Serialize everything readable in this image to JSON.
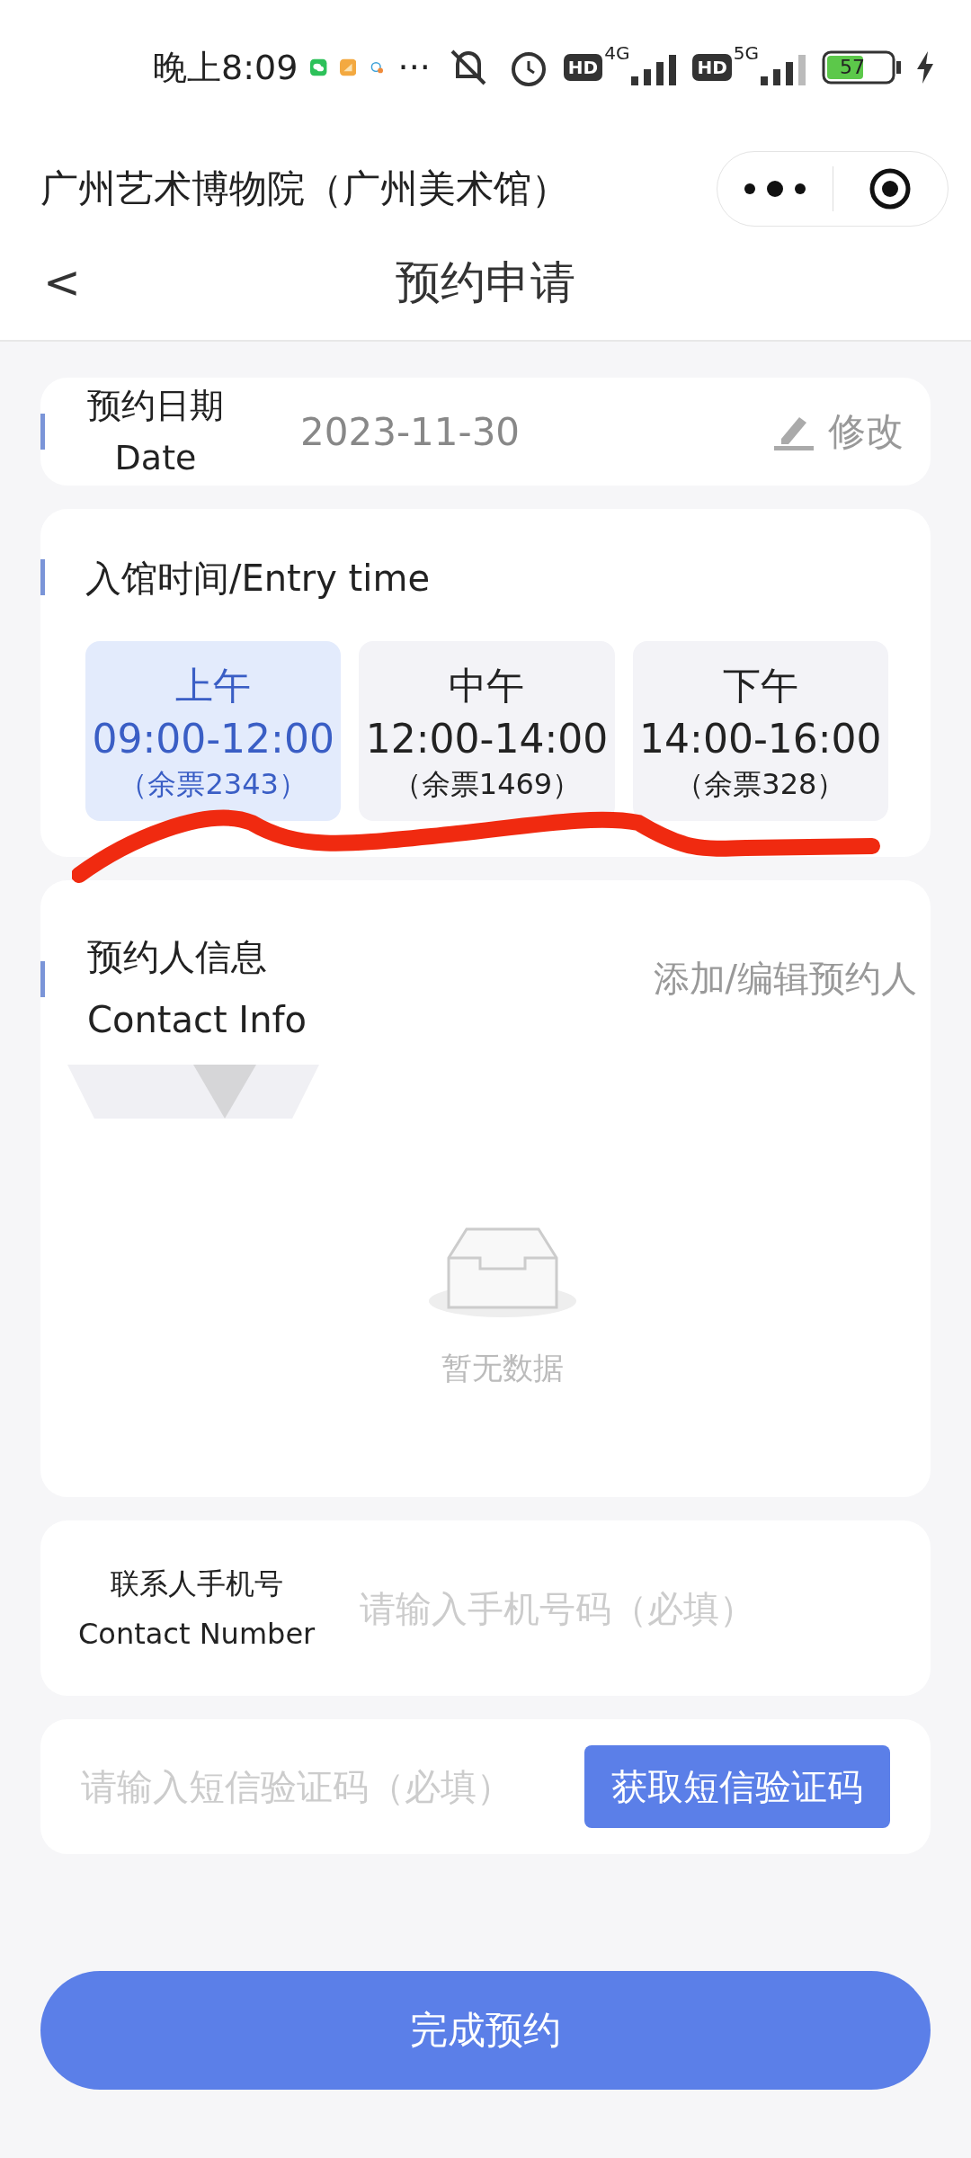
{
  "status_bar": {
    "time": "晚上8:09",
    "more": "···",
    "battery": "57",
    "network_1": "4G",
    "network_2": "5G",
    "hd_1": "HD",
    "hd_2": "HD"
  },
  "mini_program": {
    "title": "广州艺术博物院（广州美术馆）"
  },
  "nav": {
    "back": "<",
    "title": "预约申请"
  },
  "date_card": {
    "label_cn": "预约日期",
    "label_en": "Date",
    "value": "2023-11-30",
    "edit": "修改"
  },
  "entry_card": {
    "title": "入馆时间/Entry time",
    "slots": [
      {
        "period": "上午",
        "time": "09:00-12:00",
        "remaining": "（余票2343）",
        "selected": true
      },
      {
        "period": "中午",
        "time": "12:00-14:00",
        "remaining": "（余票1469）",
        "selected": false
      },
      {
        "period": "下午",
        "time": "14:00-16:00",
        "remaining": "（余票328）",
        "selected": false
      }
    ]
  },
  "contact_card": {
    "title_cn": "预约人信息",
    "title_en": "Contact Info",
    "action": "添加/编辑预约人",
    "empty_text": "暂无数据"
  },
  "phone_card": {
    "label_cn": "联系人手机号",
    "label_en": "Contact Number",
    "placeholder": "请输入手机号码（必填）"
  },
  "sms_card": {
    "placeholder": "请输入短信验证码（必填）",
    "button": "获取短信验证码"
  },
  "submit": "完成预约"
}
